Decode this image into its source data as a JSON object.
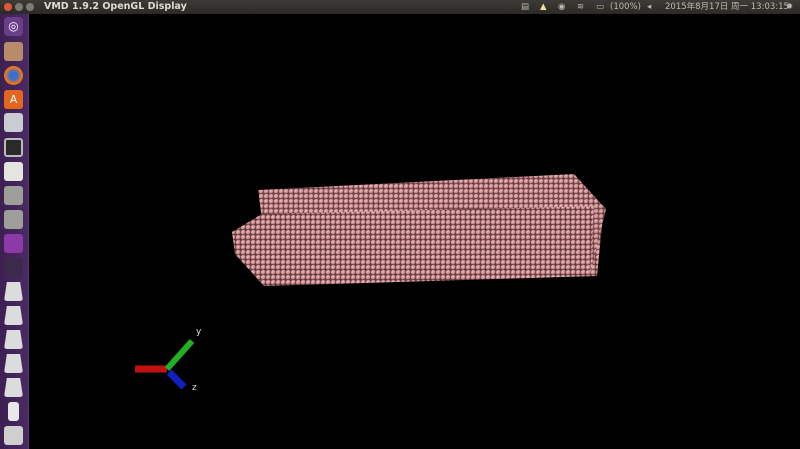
{
  "window": {
    "title": "VMD 1.9.2 OpenGL Display"
  },
  "tray": {
    "battery": "(100%)",
    "datetime": "2015年8月17日 周一 13:03:15"
  },
  "launcher": {
    "items": [
      "dash",
      "files",
      "firefox",
      "software-center",
      "system-monitor",
      "terminal",
      "text-editor",
      "app-1",
      "app-2",
      "image-viewer",
      "app-3",
      "workspace-1",
      "workspace-2",
      "workspace-3",
      "workspace-4",
      "workspace-5",
      "usb-drive",
      "trash"
    ]
  },
  "axes": {
    "y": "y",
    "z": "z"
  },
  "colors": {
    "atom": "#c98a8e",
    "x_axis": "#cc1111",
    "y_axis": "#22bb22",
    "z_axis": "#1122cc"
  }
}
